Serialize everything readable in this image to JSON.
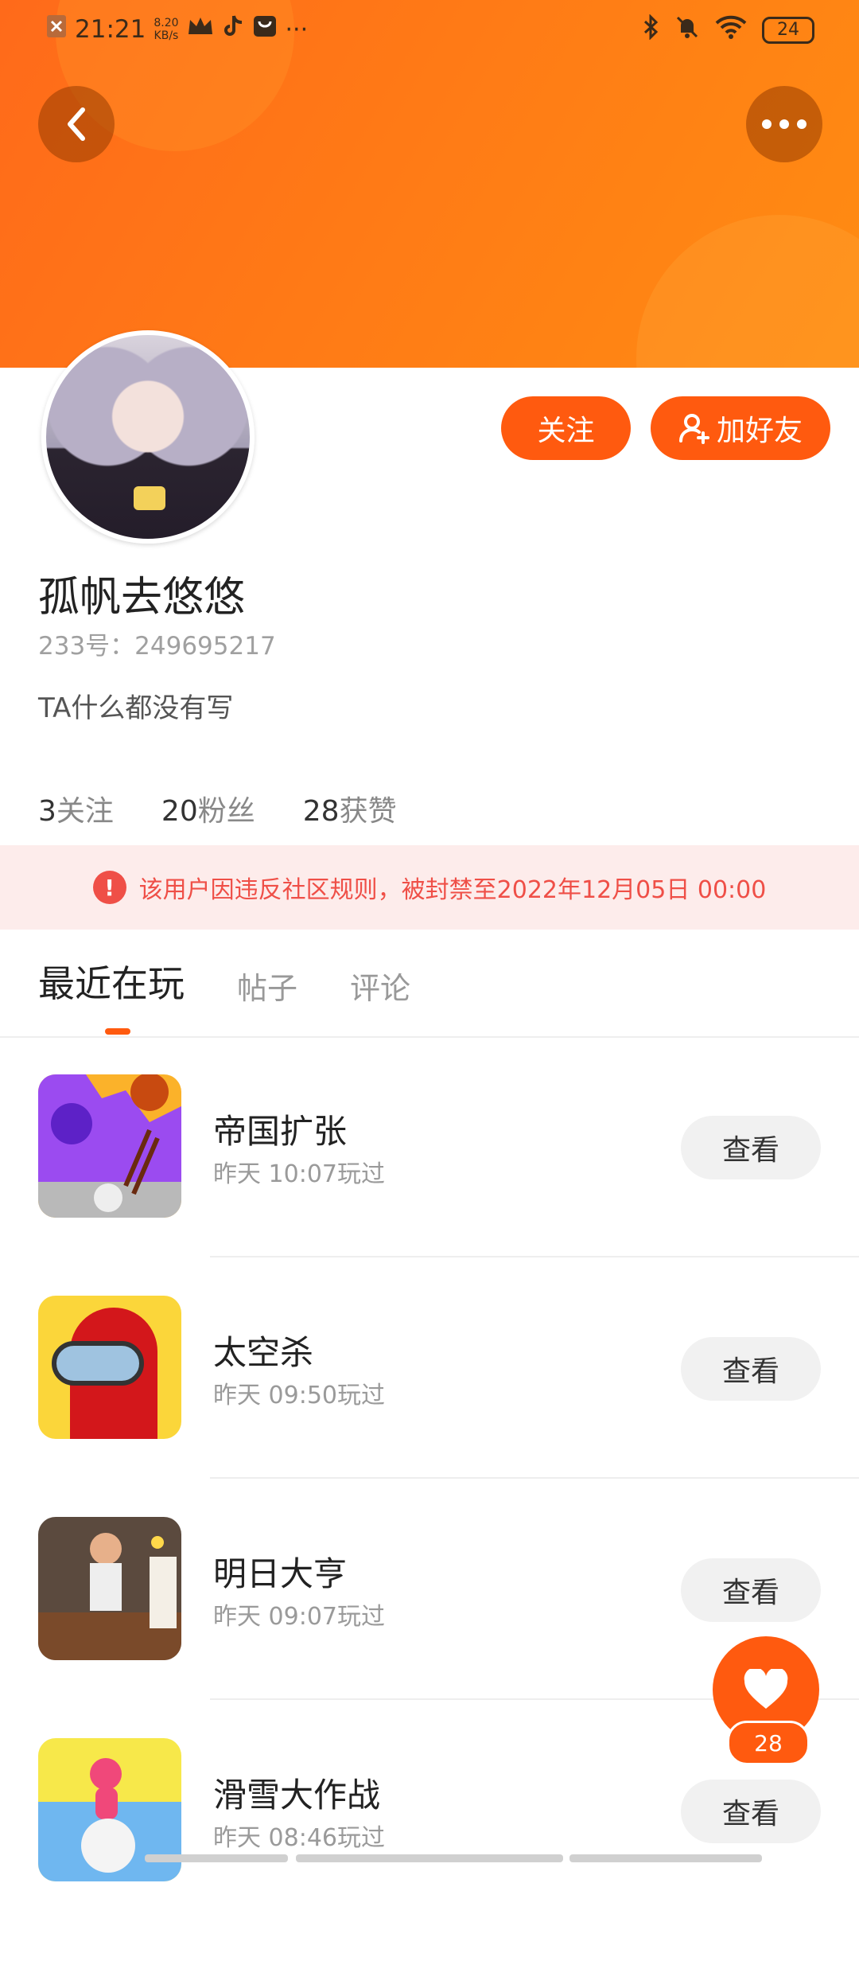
{
  "status_bar": {
    "time": "21:21",
    "net_speed_value": "8.20",
    "net_speed_unit": "KB/s",
    "more": "···",
    "battery": "24"
  },
  "header": {
    "back_icon": "chevron-left-icon",
    "more_icon": "more-horizontal-icon"
  },
  "profile": {
    "follow_label": "关注",
    "add_friend_label": "加好友",
    "name": "孤帆去悠悠",
    "uid": "233号：249695217",
    "bio": "TA什么都没有写",
    "stats": [
      {
        "num": "3",
        "label": "关注"
      },
      {
        "num": "20",
        "label": "粉丝"
      },
      {
        "num": "28",
        "label": "获赞"
      }
    ],
    "ban_notice": "该用户因违反社区规则，被封禁至2022年12月05日 00:00"
  },
  "tabs": [
    "最近在玩",
    "帖子",
    "评论"
  ],
  "games": [
    {
      "title": "帝国扩张",
      "time": "昨天 10:07玩过",
      "button": "查看"
    },
    {
      "title": "太空杀",
      "time": "昨天 09:50玩过",
      "button": "查看"
    },
    {
      "title": "明日大亨",
      "time": "昨天 09:07玩过",
      "button": "查看"
    },
    {
      "title": "滑雪大作战",
      "time": "昨天 08:46玩过",
      "button": "查看"
    }
  ],
  "like": {
    "count": "28"
  },
  "colors": {
    "accent": "#ff5a0f",
    "banner": "#ff7a16",
    "ban_text": "#ef4f47"
  }
}
